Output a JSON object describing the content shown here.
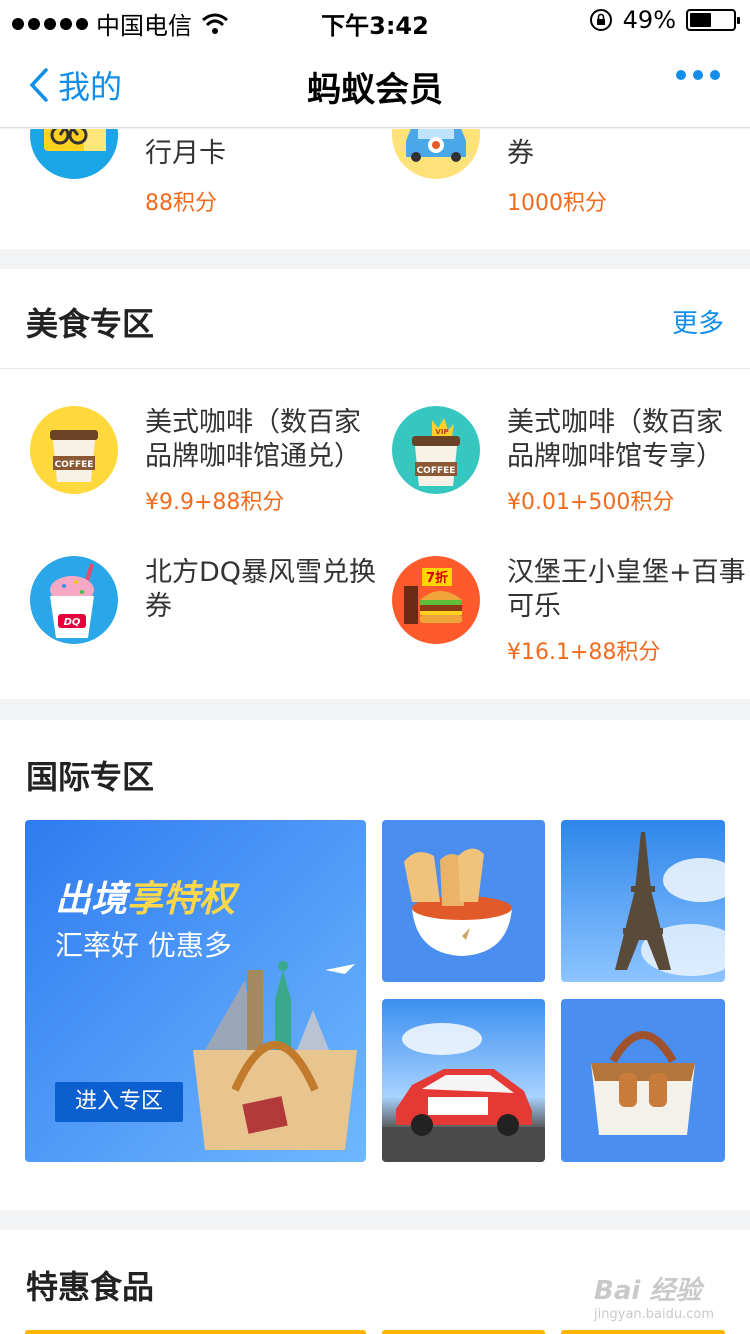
{
  "status_bar": {
    "carrier": "中国电信",
    "time": "下午3:42",
    "battery": "49%",
    "battery_level": 0.49
  },
  "nav": {
    "back_label": "我的",
    "title": "蚂蚁会员"
  },
  "top_items": [
    {
      "name": "行月卡",
      "price": "88积分",
      "icon": "bike-card-icon"
    },
    {
      "name": "券",
      "price": "1000积分",
      "icon": "car-coupon-icon"
    }
  ],
  "food": {
    "title": "美食专区",
    "more": "更多",
    "items": [
      {
        "name": "美式咖啡（数百家品牌咖啡馆通兑）",
        "price": "¥9.9+88积分",
        "icon": "coffee-cup-icon",
        "badge": "COFFEE"
      },
      {
        "name": "美式咖啡（数百家品牌咖啡馆专享）",
        "price": "¥0.01+500积分",
        "icon": "vip-coffee-cup-icon",
        "badge": "COFFEE",
        "vip": "VIP"
      },
      {
        "name": "北方DQ暴风雪兑换券",
        "price": "",
        "icon": "dq-icecream-icon",
        "badge": "DQ"
      },
      {
        "name": "汉堡王小皇堡+百事可乐",
        "price": "¥16.1+88积分",
        "icon": "burger-icon",
        "badge": "7折"
      }
    ]
  },
  "intl": {
    "title": "国际专区",
    "promo_title_a": "出境",
    "promo_title_b": "享特权",
    "promo_sub": "汇率好 优惠多",
    "promo_button": "进入专区"
  },
  "deals": {
    "title": "特惠食品"
  },
  "watermark": {
    "brand": "Bai 经验",
    "url": "jingyan.baidu.com"
  }
}
